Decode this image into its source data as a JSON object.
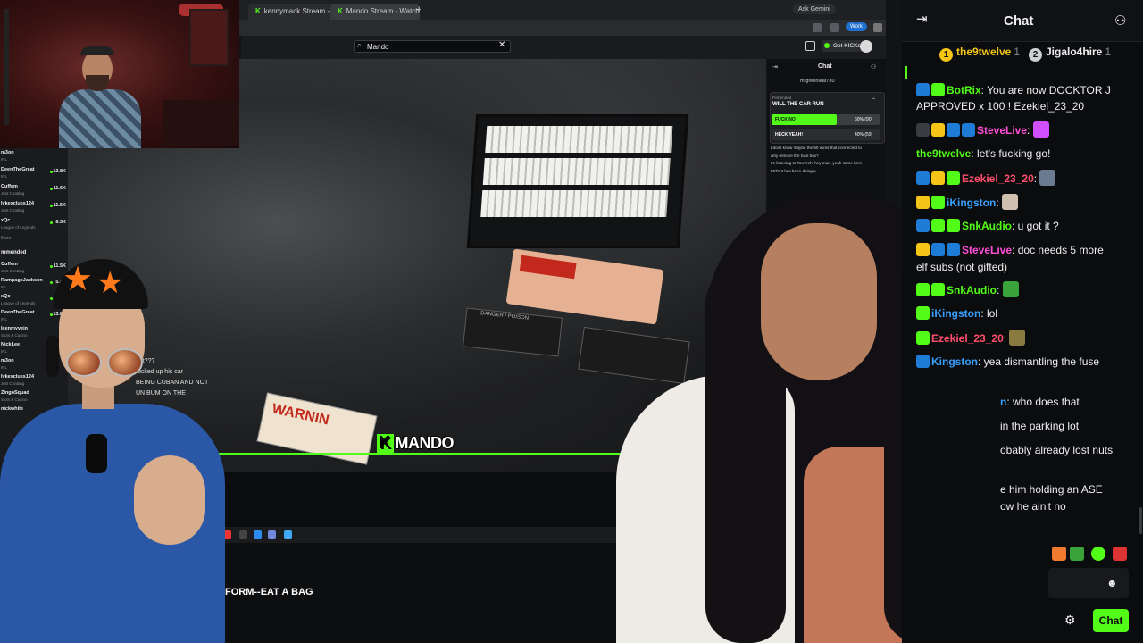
{
  "browser": {
    "tabs": [
      {
        "label": "kennymack Stream - Watch Li"
      },
      {
        "label": "Mando Stream - Watch Li"
      }
    ],
    "new_tab": "+",
    "ask_gemini": "Ask Gemini",
    "work_chip": "Work"
  },
  "kick": {
    "search": {
      "value": "Mando",
      "placeholder": "Search"
    },
    "get_kicks": "Get KICKs",
    "sidebar": {
      "following": [
        {
          "name": "m3on",
          "category": "IRL",
          "count": ""
        },
        {
          "name": "DeenTheGreat",
          "category": "IRL",
          "count": "13.8K"
        },
        {
          "name": "Cuffem",
          "category": "Just Chatting",
          "count": "11.6K"
        },
        {
          "name": "lvkexclues124",
          "category": "Just Chatting",
          "count": "11.5K"
        },
        {
          "name": "xQc",
          "category": "League of Legends",
          "count": "6.3K"
        }
      ],
      "more_label": "More",
      "recommended_label": "mmended",
      "recommended": [
        {
          "name": "Cuffem",
          "category": "Just Chatting",
          "count": "11.5K"
        },
        {
          "name": "RampageJackson",
          "category": "IRL",
          "count": "5.4K"
        },
        {
          "name": "xQc",
          "category": "League of Legends",
          "count": "6.3K"
        },
        {
          "name": "DeenTheGreat",
          "category": "IRL",
          "count": "13.8K"
        },
        {
          "name": "Icenmyvein",
          "category": "Slots & Casino",
          "count": ""
        },
        {
          "name": "NickLee",
          "category": "IRL",
          "count": ""
        },
        {
          "name": "m3on",
          "category": "IRL",
          "count": ""
        },
        {
          "name": "lvkexclues124",
          "category": "Just Chatting",
          "count": ""
        },
        {
          "name": "ZingoSquad",
          "category": "Slots & Casino",
          "count": ""
        },
        {
          "name": "nickwhite",
          "category": "",
          "count": ""
        }
      ]
    },
    "video": {
      "warning_sticker": "WARNIN",
      "danger_label": "DANGER / POISON",
      "streamer_tag": "MANDO",
      "streamer_tag_k": "K",
      "overlay_chat": [
        "out???",
        "fucked up his car",
        "",
        "BEING CUBAN AND NOT",
        "UN BUM ON THE"
      ]
    },
    "ticker": "FORM--EAT A BAG",
    "mini_chat": {
      "title": "Chat",
      "pinned_by": "mrgreenleaf730",
      "poll": {
        "header": "Poll ended",
        "question": "WILL THE CAR RUN",
        "options": [
          {
            "label": "FUCK NO",
            "pct_text": "60% (90)",
            "pct": 0.6
          },
          {
            "label": "HECK YEAH!",
            "pct_text": "40% (59)",
            "pct": 0.4
          }
        ]
      },
      "messages": [
        "I don't know maybe the 50 wires that connected to",
        "why remove the fuse box?",
        "Im listening to TooTech. hey man, yeah same here",
        "MrTent  has been doing a"
      ]
    }
  },
  "chat": {
    "title": "Chat",
    "send_label": "Chat",
    "top_gifters": [
      {
        "rank": "1",
        "name": "the9twelve",
        "count": "1",
        "color": "#f5c518"
      },
      {
        "rank": "2",
        "name": "Jigalo4hire",
        "count": "1",
        "color": "#cfd0d3"
      }
    ],
    "messages": [
      {
        "user": "BotRix",
        "color": "#53fc18",
        "text": "You are now DOCKTOR J APPROVED x 100 ! Ezekiel_23_20"
      },
      {
        "user": "SteveLive",
        "color": "#ff4fd8",
        "text": ""
      },
      {
        "user": "the9twelve",
        "color": "#53fc18",
        "text": "let's fucking go!"
      },
      {
        "user": "Ezekiel_23_20",
        "color": "#ff4f6d",
        "text": ""
      },
      {
        "user": "iKingston",
        "color": "#3aa0ff",
        "text": ""
      },
      {
        "user": "SnkAudio",
        "color": "#53fc18",
        "text": "u got it ?"
      },
      {
        "user": "SteveLive",
        "color": "#ff4fd8",
        "text": "doc needs 5 more"
      },
      {
        "user": "",
        "color": "#efeff1",
        "text": "elf subs (not gifted)"
      },
      {
        "user": "SnkAudio",
        "color": "#53fc18",
        "text": ""
      },
      {
        "user": "iKingston",
        "color": "#3aa0ff",
        "text": "lol"
      },
      {
        "user": "Ezekiel_23_20",
        "color": "#ff4f6d",
        "text": ""
      },
      {
        "user": "Kingston",
        "color": "#3aa0ff",
        "text": "yea dismantling the fuse"
      },
      {
        "user": "n",
        "color": "#3aa0ff",
        "text": "who does that"
      },
      {
        "user": "",
        "color": "#efeff1",
        "text": "in the parking lot"
      },
      {
        "user": "",
        "color": "#efeff1",
        "text": "obably already lost nuts"
      },
      {
        "user": "",
        "color": "#efeff1",
        "text": "e him holding an ASE"
      },
      {
        "user": "",
        "color": "#efeff1",
        "text": "ow he ain't no"
      }
    ],
    "badges": {
      "sub_22": "22",
      "sub_39": "39",
      "sub_31": "31",
      "sub_1": "1"
    }
  },
  "colors": {
    "accent": "#53fc18",
    "bg": "#0b0c0d",
    "panel": "#191b1f"
  }
}
